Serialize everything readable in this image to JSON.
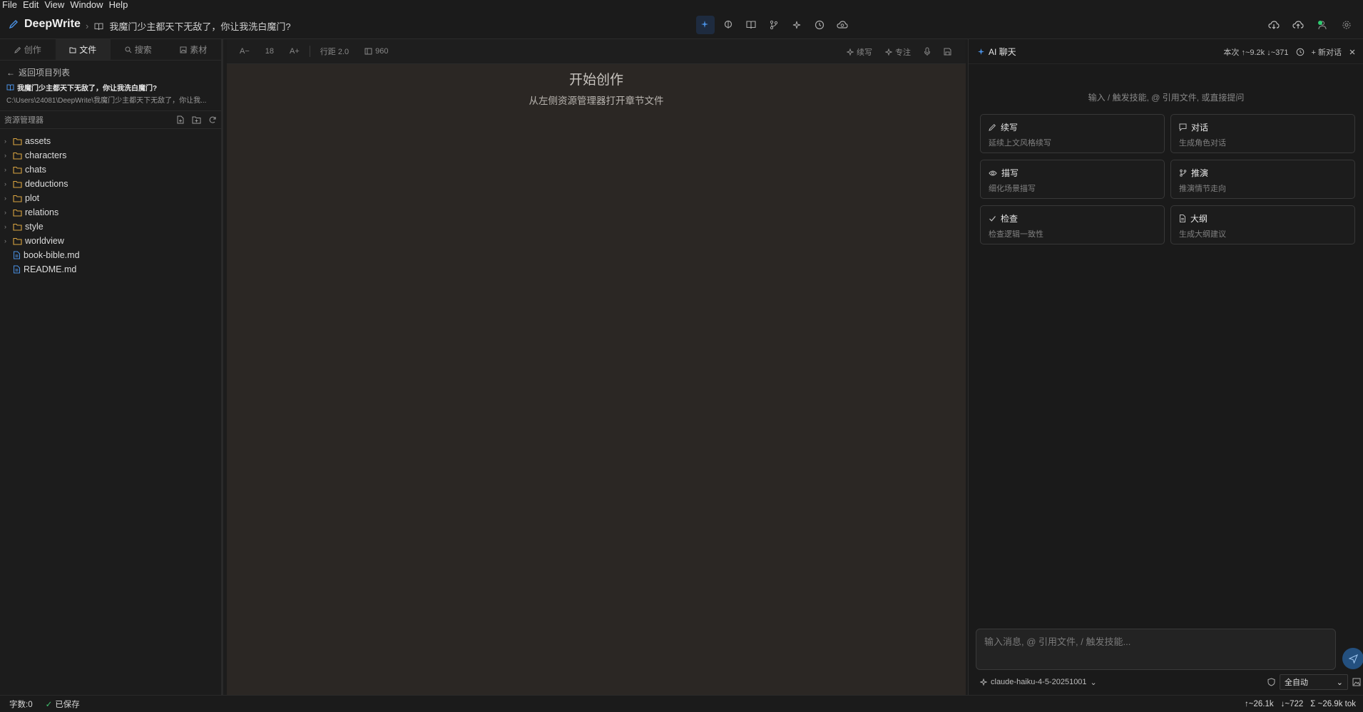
{
  "menu": [
    "File",
    "Edit",
    "View",
    "Window",
    "Help"
  ],
  "app": {
    "name": "DeepWrite"
  },
  "breadcrumb": {
    "project": "我魔门少主都天下无敌了，你让我洗白魔门?"
  },
  "left": {
    "tabs": [
      {
        "label": "创作",
        "icon": "pencil-icon"
      },
      {
        "label": "文件",
        "icon": "file-icon"
      },
      {
        "label": "搜索",
        "icon": "search-icon"
      },
      {
        "label": "素材",
        "icon": "image-icon"
      }
    ],
    "back_label": "返回项目列表",
    "project_name": "我魔门少主都天下无敌了，你让我洗白魔门?",
    "project_path": "C:\\Users\\24081\\DeepWrite\\我魔门少主都天下无敌了，你让我...",
    "explorer_title": "资源管理器",
    "tree": [
      {
        "name": "assets",
        "type": "folder"
      },
      {
        "name": "characters",
        "type": "folder"
      },
      {
        "name": "chats",
        "type": "folder"
      },
      {
        "name": "deductions",
        "type": "folder"
      },
      {
        "name": "plot",
        "type": "folder"
      },
      {
        "name": "relations",
        "type": "folder"
      },
      {
        "name": "style",
        "type": "folder"
      },
      {
        "name": "worldview",
        "type": "folder"
      },
      {
        "name": "book-bible.md",
        "type": "file"
      },
      {
        "name": "README.md",
        "type": "file"
      }
    ]
  },
  "editor": {
    "font_dec": "A−",
    "font_size": "18",
    "font_inc": "A+",
    "line_height": "行距 2.0",
    "width": "960",
    "continue_label": "续写",
    "focus_label": "专注",
    "empty_title": "开始创作",
    "empty_subtitle": "从左侧资源管理器打开章节文件"
  },
  "chat": {
    "title": "AI 聊天",
    "stats": "本次 ↑~9.2k ↓~371",
    "new_chat": "新对话",
    "hint": "输入 / 触发技能, @ 引用文件, 或直接提问",
    "cards": [
      {
        "title": "续写",
        "desc": "延续上文风格续写",
        "icon": "pencil-icon"
      },
      {
        "title": "对话",
        "desc": "生成角色对话",
        "icon": "chat-bubble-icon"
      },
      {
        "title": "描写",
        "desc": "细化场景描写",
        "icon": "eye-icon"
      },
      {
        "title": "推演",
        "desc": "推演情节走向",
        "icon": "branch-icon"
      },
      {
        "title": "检查",
        "desc": "检查逻辑一致性",
        "icon": "check-icon"
      },
      {
        "title": "大纲",
        "desc": "生成大纲建议",
        "icon": "document-icon"
      }
    ],
    "input_placeholder": "输入消息, @ 引用文件, / 触发技能...",
    "model": "claude-haiku-4-5-20251001",
    "mode": "全自动"
  },
  "status": {
    "word_count": "字数:0",
    "saved": "已保存",
    "tokens_up": "↑~26.1k",
    "tokens_down": "↓~722",
    "tokens_total": "Σ ~26.9k tok"
  },
  "colors": {
    "accent": "#4a90e2",
    "folder": "#d9a441",
    "ok": "#2ecc71"
  }
}
